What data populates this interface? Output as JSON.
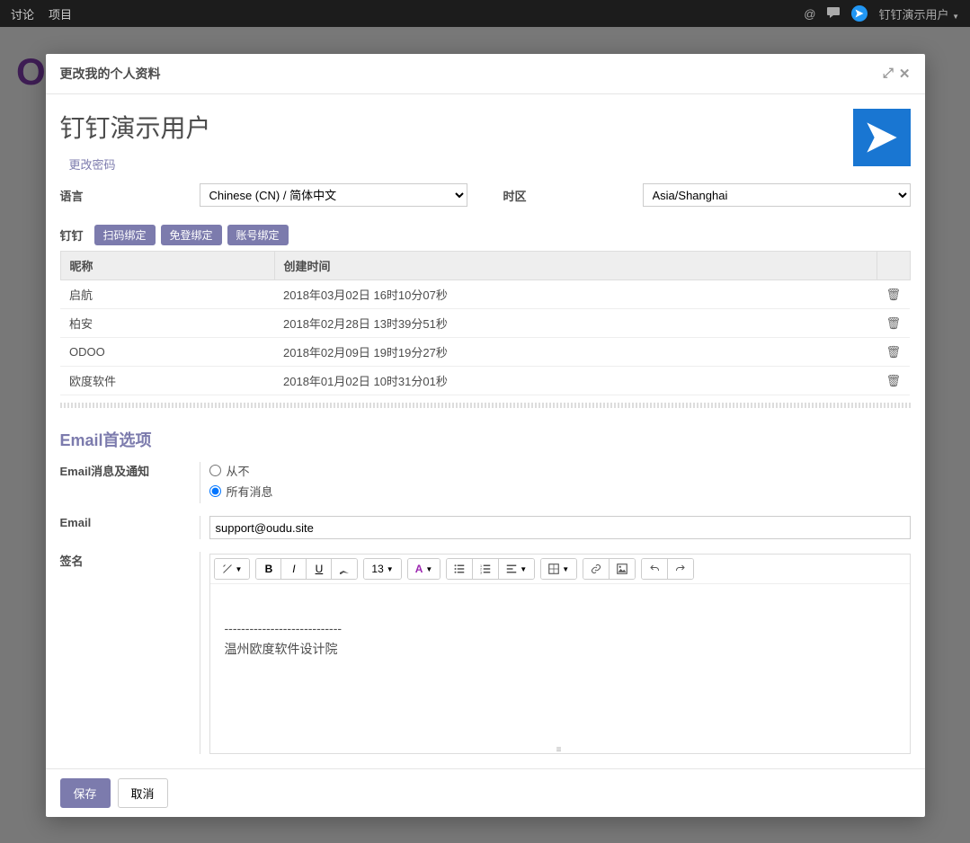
{
  "topnav": {
    "items": [
      "讨论",
      "项目"
    ],
    "username": "钉钉演示用户"
  },
  "modal": {
    "title": "更改我的个人资料",
    "page_title": "钉钉演示用户",
    "change_password": "更改密码"
  },
  "fields": {
    "language_label": "语言",
    "language_value": "Chinese (CN) / 简体中文",
    "timezone_label": "时区",
    "timezone_value": "Asia/Shanghai"
  },
  "binding": {
    "label": "钉钉",
    "buttons": [
      "扫码绑定",
      "免登绑定",
      "账号绑定"
    ]
  },
  "table": {
    "headers": {
      "nickname": "昵称",
      "created": "创建时间"
    },
    "rows": [
      {
        "nickname": "启航",
        "created": "2018年03月02日 16时10分07秒"
      },
      {
        "nickname": "柏安",
        "created": "2018年02月28日 13时39分51秒"
      },
      {
        "nickname": "ODOO",
        "created": "2018年02月09日 19时19分27秒"
      },
      {
        "nickname": "欧度软件",
        "created": "2018年01月02日 10时31分01秒"
      }
    ]
  },
  "email_prefs": {
    "section_title": "Email首选项",
    "notify_label": "Email消息及通知",
    "options": {
      "never": "从不",
      "all": "所有消息"
    },
    "selected": "all",
    "email_label": "Email",
    "email_value": "support@oudu.site",
    "signature_label": "签名",
    "font_size": "13",
    "signature_content_line1": "----------------------------",
    "signature_content_line2": "温州欧度软件设计院"
  },
  "footer": {
    "save": "保存",
    "cancel": "取消"
  }
}
